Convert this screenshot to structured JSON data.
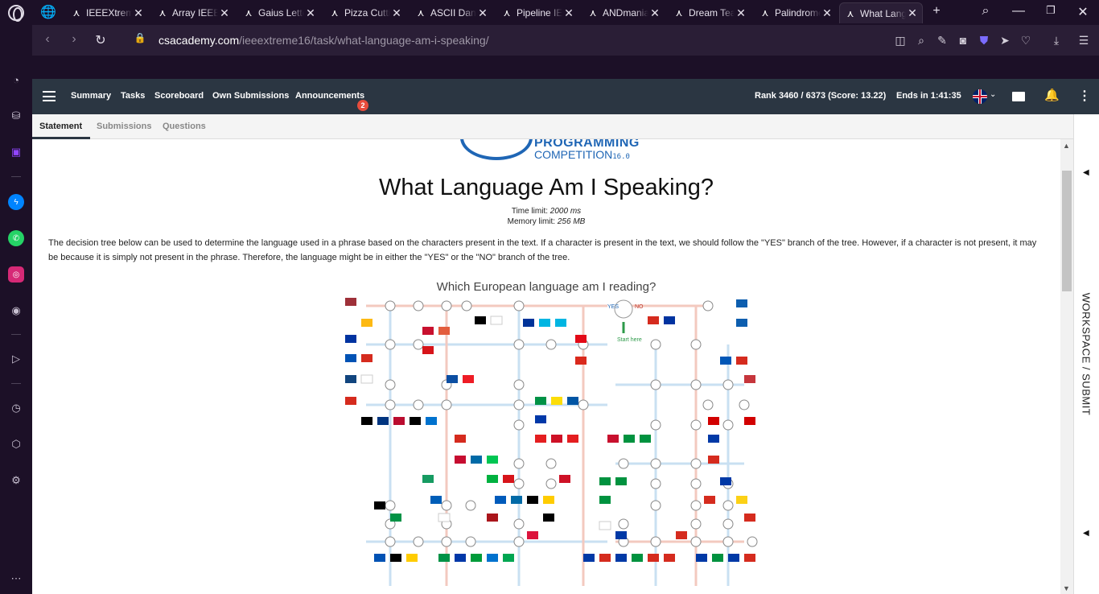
{
  "browser": {
    "tabs": [
      {
        "label": "IEEEXtreme"
      },
      {
        "label": "Array IEEE"
      },
      {
        "label": "Gaius Letters"
      },
      {
        "label": "Pizza Cutting"
      },
      {
        "label": "ASCII Dance"
      },
      {
        "label": "Pipeline IEEE"
      },
      {
        "label": "ANDmania"
      },
      {
        "label": "Dream Team"
      },
      {
        "label": "Palindrome"
      },
      {
        "label": "What Language"
      }
    ],
    "url_host": "csacademy.com",
    "url_path": "/ieeextreme16/task/what-language-am-i-speaking/"
  },
  "header": {
    "nav": [
      "Summary",
      "Tasks",
      "Scoreboard",
      "Own Submissions",
      "Announcements"
    ],
    "announcements_badge": "2",
    "rank": "Rank 3460 / 6373 (Score: 13.22)",
    "ends": "Ends in 1:41:35"
  },
  "subtabs": [
    "Statement",
    "Submissions",
    "Questions"
  ],
  "problem": {
    "logo_line1": "PROGRAMMING",
    "logo_line2": "COMPETITION",
    "logo_version": "16.0",
    "title": "What Language Am I Speaking?",
    "time_limit_label": "Time limit:",
    "time_limit_value": "2000 ms",
    "memory_limit_label": "Memory limit:",
    "memory_limit_value": "256 MB",
    "statement": "The decision tree below can be used to determine the language used in a phrase based on the characters present in the text. If a character is present in the text, we should follow the \"YES\" branch of the tree. However, if a character is not present, it may be because it is simply not present in the phrase. Therefore, the language might be in either the \"YES\" or the \"NO\" branch of the tree.",
    "tree_title": "Which European language am I reading?",
    "tree_yes": "YES",
    "tree_no": "NO",
    "tree_start": "Start here"
  },
  "workspace": {
    "label": "WORKSPACE / SUBMIT"
  },
  "colors": {
    "browser_bg": "#1c1027",
    "site_header": "#2b3642",
    "badge": "#e74c3c",
    "accent_blue": "#1f66b5"
  }
}
